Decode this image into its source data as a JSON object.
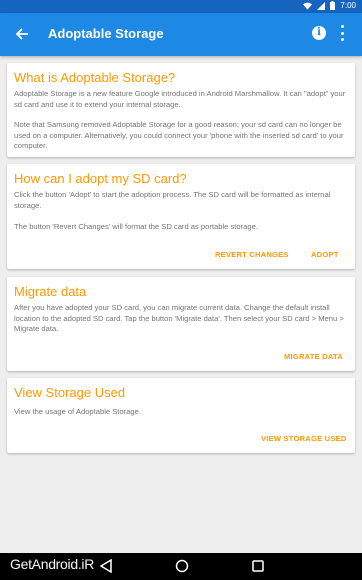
{
  "status_bar": {
    "time": "7:00",
    "icons": [
      "wifi-icon",
      "cellular-signal-icon",
      "battery-icon"
    ]
  },
  "app_bar": {
    "title": "Adoptable Storage",
    "back_icon": "arrow-back-icon",
    "info_icon": "info-icon",
    "more_icon": "more-vert-icon",
    "color": "#1e88e5"
  },
  "cards": {
    "what": {
      "title": "What is Adoptable Storage?",
      "body_1": "Adoptable Storage is a new feature Google introduced in Android Marshmallow. It can \"adopt\" your sd card and use it to extend your internal storage.",
      "body_2": "Note that Samsung removed Adoptable Storage for a good reason; your sd card can no longer be used on a computer. Alternatively, you could connect your 'phone with the inserted sd card' to your computer."
    },
    "adopt": {
      "title": "How can I adopt my SD card?",
      "body_1": "Click the button 'Adopt' to start the adoption process. The SD card will be formatted as internal storage.",
      "body_2": "The button 'Revert Changes' will format the SD card as portable storage.",
      "revert_button": "REVERT CHANGES",
      "adopt_button": "ADOPT"
    },
    "migrate": {
      "title": "Migrate data",
      "body": "After you have adopted your SD card, you can migrate current data. Change the default install location to the adopted SD card. Tap the button 'Migrate data'. Then select your SD card > Menu > Migrate data.",
      "button": "MIGRATE DATA"
    },
    "view": {
      "title": "View Storage Used",
      "body": "View the usage of Adoptable Storage.",
      "button": "VIEW STORAGE USED"
    }
  },
  "accent_color": "#ff9800",
  "watermark": "GetAndroid.iR",
  "nav_bar": {
    "icons": [
      "back-triangle-icon",
      "home-circle-icon",
      "recents-square-icon"
    ]
  }
}
